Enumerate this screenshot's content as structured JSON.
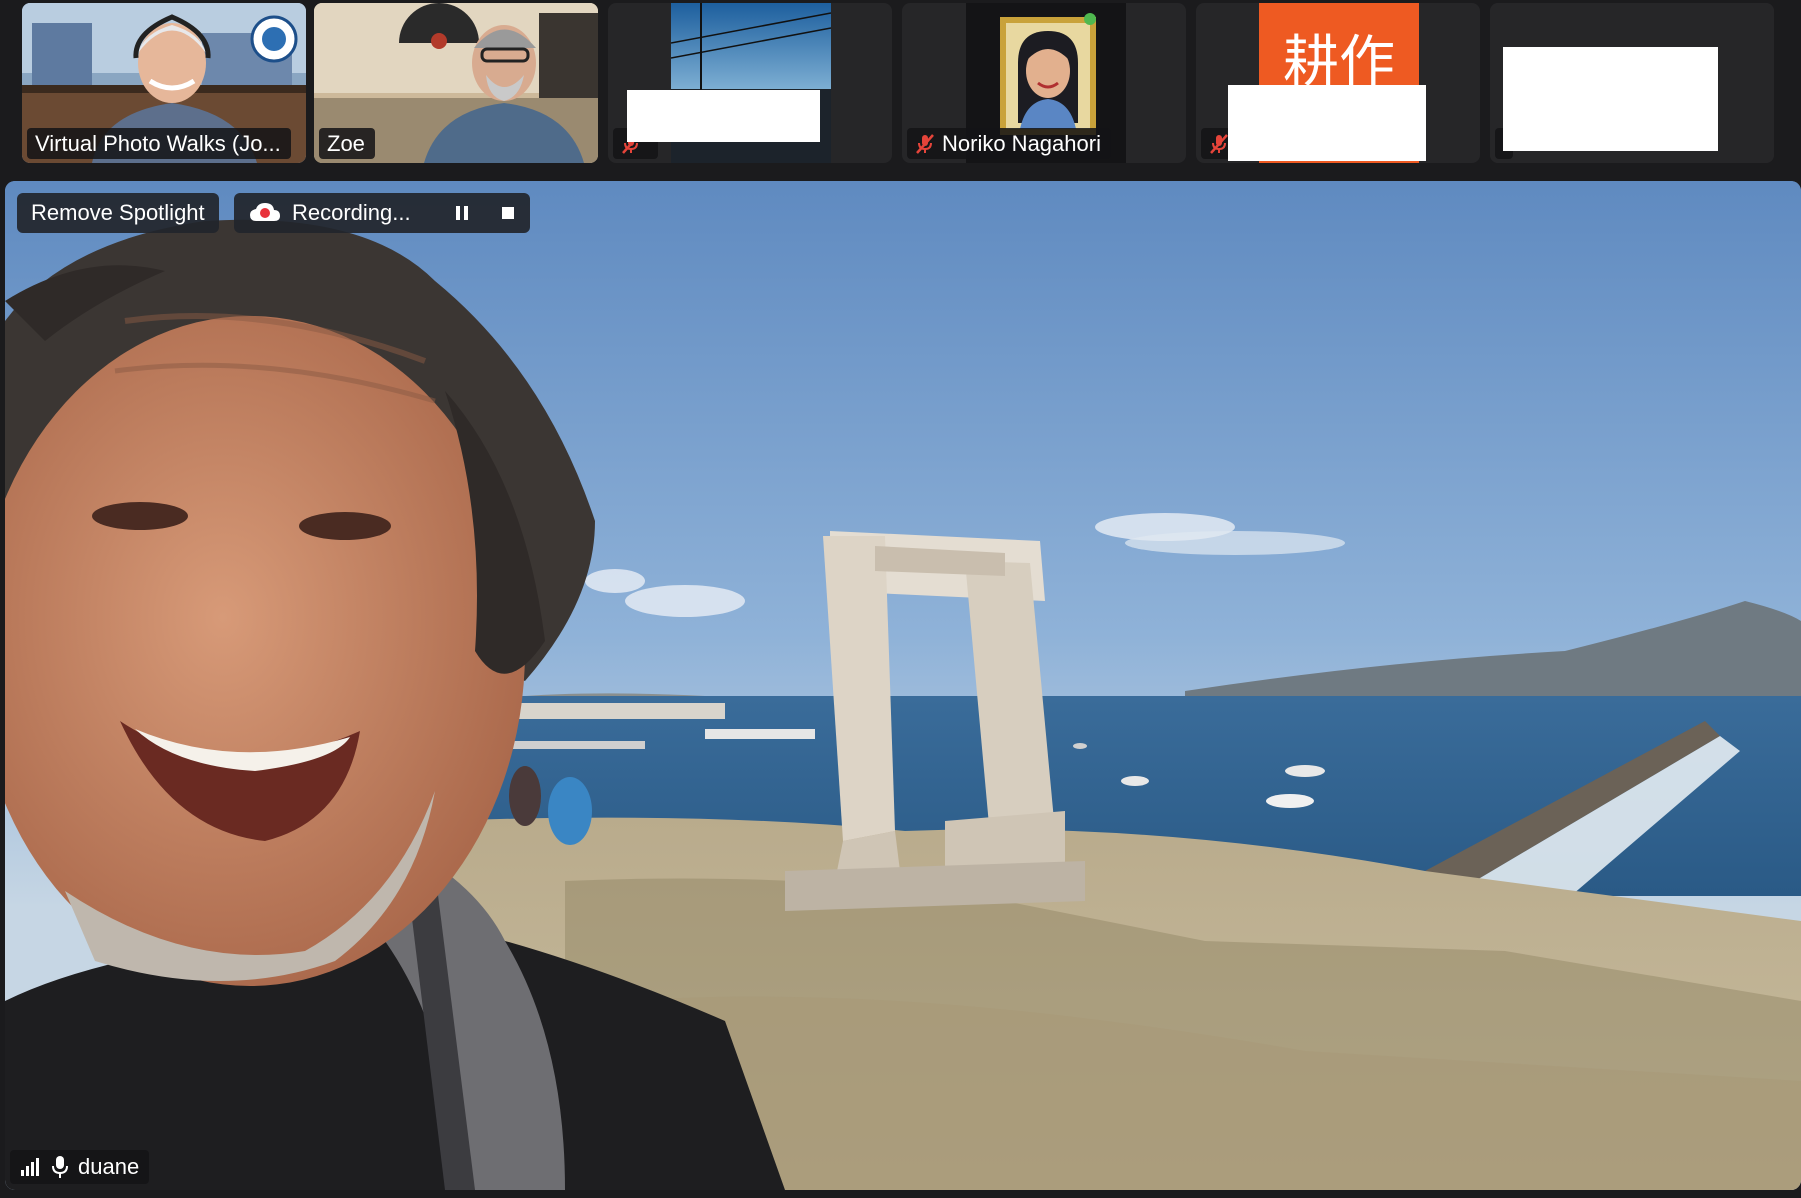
{
  "participants": [
    {
      "name": "Virtual Photo Walks (Jo...",
      "muted": false
    },
    {
      "name": "Zoe",
      "muted": false
    },
    {
      "name": "",
      "muted": true
    },
    {
      "name": "Noriko Nagahori",
      "muted": true
    },
    {
      "name": "",
      "muted": true
    },
    {
      "name": "",
      "muted": false
    }
  ],
  "tile5_sign_text": "耕作",
  "controls": {
    "remove_spotlight_label": "Remove Spotlight",
    "recording_label": "Recording..."
  },
  "speaker": {
    "name": "duane"
  },
  "colors": {
    "background": "#1b1b1d",
    "tile_background": "#262628",
    "mute_red": "#e5443a",
    "recording_red": "#e8313a",
    "sign_orange": "#ee5a22"
  },
  "icons": {
    "signal": "signal-bars-icon",
    "mic_active": "microphone-icon",
    "mic_muted": "muted-microphone-icon",
    "recording": "cloud-recording-icon",
    "pause": "pause-icon",
    "stop": "stop-icon"
  }
}
